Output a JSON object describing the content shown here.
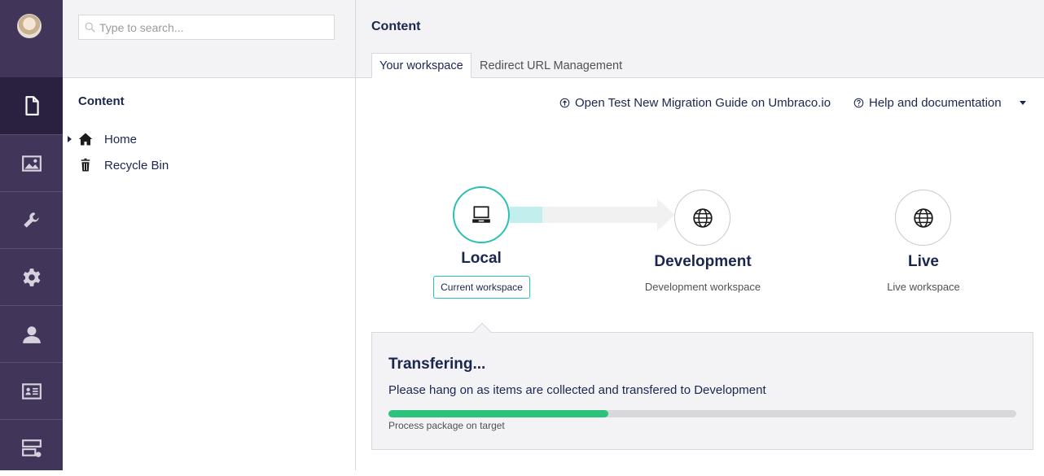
{
  "rail": {
    "sections": [
      {
        "name": "content",
        "icon": "document-icon",
        "active": true
      },
      {
        "name": "media",
        "icon": "image-icon",
        "active": false
      },
      {
        "name": "settings",
        "icon": "wrench-icon",
        "active": false
      },
      {
        "name": "developer",
        "icon": "gear-icon",
        "active": false
      },
      {
        "name": "users",
        "icon": "user-icon",
        "active": false
      },
      {
        "name": "members",
        "icon": "id-card-icon",
        "active": false
      },
      {
        "name": "forms",
        "icon": "form-icon",
        "active": false
      }
    ]
  },
  "tree": {
    "search_placeholder": "Type to search...",
    "title": "Content",
    "nodes": [
      {
        "label": "Home",
        "icon": "home-icon",
        "has_children": true
      },
      {
        "label": "Recycle Bin",
        "icon": "trash-icon",
        "has_children": false
      }
    ]
  },
  "header": {
    "title": "Content",
    "tabs": [
      {
        "label": "Your workspace",
        "active": true
      },
      {
        "label": "Redirect URL Management",
        "active": false
      }
    ]
  },
  "links": {
    "migration": "Open Test New Migration Guide on Umbraco.io",
    "help": "Help and documentation"
  },
  "workspaces": {
    "local": {
      "name": "Local",
      "badge": "Current workspace",
      "icon": "laptop-icon"
    },
    "development": {
      "name": "Development",
      "subtitle": "Development workspace",
      "icon": "globe-icon"
    },
    "live": {
      "name": "Live",
      "subtitle": "Live workspace",
      "icon": "globe-icon"
    }
  },
  "transfer": {
    "title": "Transfering...",
    "message": "Please hang on as items are collected and transfered to Development",
    "progress": 0.35,
    "step": "Process package on target"
  },
  "colors": {
    "rail_bg": "#413659",
    "rail_active": "#2a2140",
    "accent_teal": "#2bc0b4",
    "progress_green": "#2bc37c",
    "panel_bg": "#f3f3f5"
  }
}
